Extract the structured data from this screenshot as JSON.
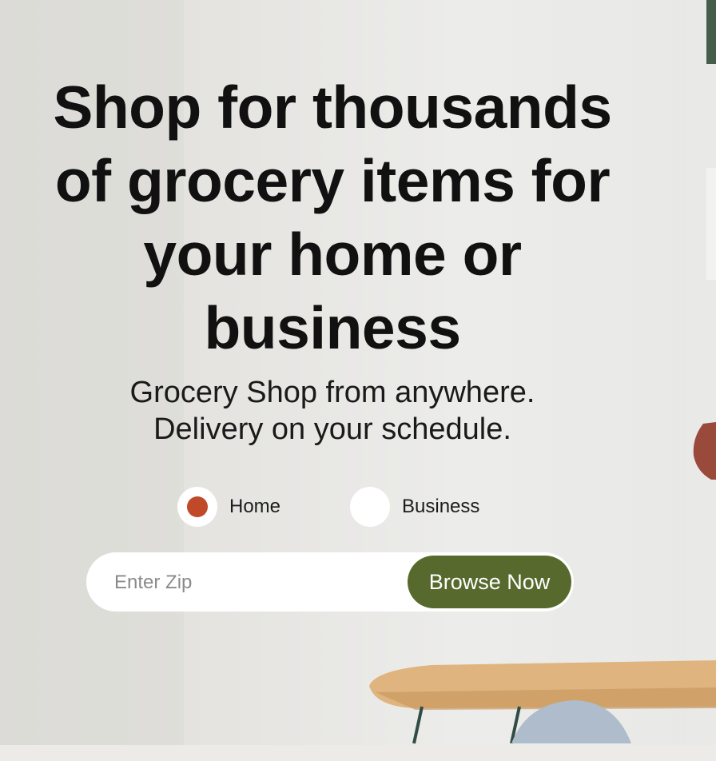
{
  "hero": {
    "headline_lines": [
      "Shop for thousands",
      "of grocery items for",
      "your home or",
      "business"
    ],
    "subhead_lines": [
      "Grocery Shop from anywhere.",
      "Delivery on your schedule."
    ]
  },
  "customer_type": {
    "options": [
      {
        "label": "Home",
        "selected": true
      },
      {
        "label": "Business",
        "selected": false
      }
    ]
  },
  "zip_search": {
    "value": "",
    "placeholder": "Enter Zip",
    "button_label": "Browse Now"
  },
  "colors": {
    "accent_button": "#57692d",
    "radio_selected": "#c0492a"
  }
}
